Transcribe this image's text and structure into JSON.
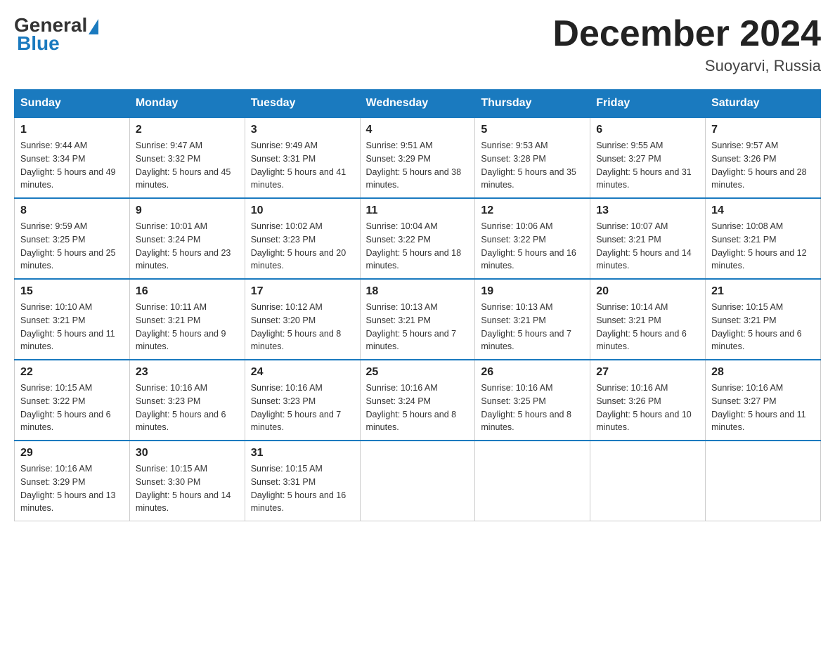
{
  "logo": {
    "general": "General",
    "blue": "Blue"
  },
  "title": "December 2024",
  "location": "Suoyarvi, Russia",
  "days_of_week": [
    "Sunday",
    "Monday",
    "Tuesday",
    "Wednesday",
    "Thursday",
    "Friday",
    "Saturday"
  ],
  "weeks": [
    [
      {
        "day": "1",
        "sunrise": "9:44 AM",
        "sunset": "3:34 PM",
        "daylight": "5 hours and 49 minutes."
      },
      {
        "day": "2",
        "sunrise": "9:47 AM",
        "sunset": "3:32 PM",
        "daylight": "5 hours and 45 minutes."
      },
      {
        "day": "3",
        "sunrise": "9:49 AM",
        "sunset": "3:31 PM",
        "daylight": "5 hours and 41 minutes."
      },
      {
        "day": "4",
        "sunrise": "9:51 AM",
        "sunset": "3:29 PM",
        "daylight": "5 hours and 38 minutes."
      },
      {
        "day": "5",
        "sunrise": "9:53 AM",
        "sunset": "3:28 PM",
        "daylight": "5 hours and 35 minutes."
      },
      {
        "day": "6",
        "sunrise": "9:55 AM",
        "sunset": "3:27 PM",
        "daylight": "5 hours and 31 minutes."
      },
      {
        "day": "7",
        "sunrise": "9:57 AM",
        "sunset": "3:26 PM",
        "daylight": "5 hours and 28 minutes."
      }
    ],
    [
      {
        "day": "8",
        "sunrise": "9:59 AM",
        "sunset": "3:25 PM",
        "daylight": "5 hours and 25 minutes."
      },
      {
        "day": "9",
        "sunrise": "10:01 AM",
        "sunset": "3:24 PM",
        "daylight": "5 hours and 23 minutes."
      },
      {
        "day": "10",
        "sunrise": "10:02 AM",
        "sunset": "3:23 PM",
        "daylight": "5 hours and 20 minutes."
      },
      {
        "day": "11",
        "sunrise": "10:04 AM",
        "sunset": "3:22 PM",
        "daylight": "5 hours and 18 minutes."
      },
      {
        "day": "12",
        "sunrise": "10:06 AM",
        "sunset": "3:22 PM",
        "daylight": "5 hours and 16 minutes."
      },
      {
        "day": "13",
        "sunrise": "10:07 AM",
        "sunset": "3:21 PM",
        "daylight": "5 hours and 14 minutes."
      },
      {
        "day": "14",
        "sunrise": "10:08 AM",
        "sunset": "3:21 PM",
        "daylight": "5 hours and 12 minutes."
      }
    ],
    [
      {
        "day": "15",
        "sunrise": "10:10 AM",
        "sunset": "3:21 PM",
        "daylight": "5 hours and 11 minutes."
      },
      {
        "day": "16",
        "sunrise": "10:11 AM",
        "sunset": "3:21 PM",
        "daylight": "5 hours and 9 minutes."
      },
      {
        "day": "17",
        "sunrise": "10:12 AM",
        "sunset": "3:20 PM",
        "daylight": "5 hours and 8 minutes."
      },
      {
        "day": "18",
        "sunrise": "10:13 AM",
        "sunset": "3:21 PM",
        "daylight": "5 hours and 7 minutes."
      },
      {
        "day": "19",
        "sunrise": "10:13 AM",
        "sunset": "3:21 PM",
        "daylight": "5 hours and 7 minutes."
      },
      {
        "day": "20",
        "sunrise": "10:14 AM",
        "sunset": "3:21 PM",
        "daylight": "5 hours and 6 minutes."
      },
      {
        "day": "21",
        "sunrise": "10:15 AM",
        "sunset": "3:21 PM",
        "daylight": "5 hours and 6 minutes."
      }
    ],
    [
      {
        "day": "22",
        "sunrise": "10:15 AM",
        "sunset": "3:22 PM",
        "daylight": "5 hours and 6 minutes."
      },
      {
        "day": "23",
        "sunrise": "10:16 AM",
        "sunset": "3:23 PM",
        "daylight": "5 hours and 6 minutes."
      },
      {
        "day": "24",
        "sunrise": "10:16 AM",
        "sunset": "3:23 PM",
        "daylight": "5 hours and 7 minutes."
      },
      {
        "day": "25",
        "sunrise": "10:16 AM",
        "sunset": "3:24 PM",
        "daylight": "5 hours and 8 minutes."
      },
      {
        "day": "26",
        "sunrise": "10:16 AM",
        "sunset": "3:25 PM",
        "daylight": "5 hours and 8 minutes."
      },
      {
        "day": "27",
        "sunrise": "10:16 AM",
        "sunset": "3:26 PM",
        "daylight": "5 hours and 10 minutes."
      },
      {
        "day": "28",
        "sunrise": "10:16 AM",
        "sunset": "3:27 PM",
        "daylight": "5 hours and 11 minutes."
      }
    ],
    [
      {
        "day": "29",
        "sunrise": "10:16 AM",
        "sunset": "3:29 PM",
        "daylight": "5 hours and 13 minutes."
      },
      {
        "day": "30",
        "sunrise": "10:15 AM",
        "sunset": "3:30 PM",
        "daylight": "5 hours and 14 minutes."
      },
      {
        "day": "31",
        "sunrise": "10:15 AM",
        "sunset": "3:31 PM",
        "daylight": "5 hours and 16 minutes."
      },
      null,
      null,
      null,
      null
    ]
  ]
}
